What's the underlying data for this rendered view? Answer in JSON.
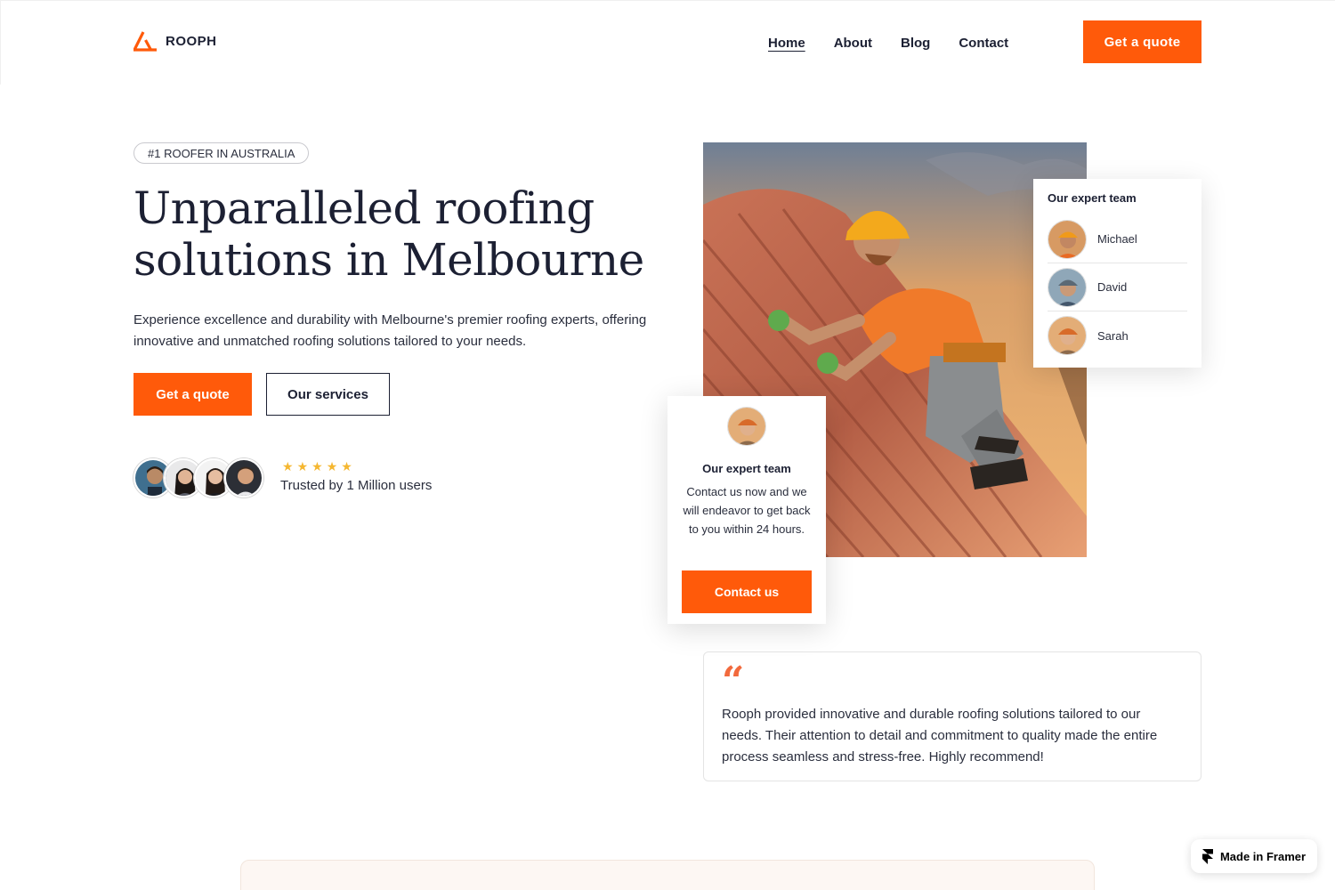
{
  "brand": {
    "name": "ROOPH",
    "accent": "#ff5a0a"
  },
  "nav": {
    "items": [
      {
        "label": "Home",
        "active": true
      },
      {
        "label": "About",
        "active": false
      },
      {
        "label": "Blog",
        "active": false
      },
      {
        "label": "Contact",
        "active": false
      }
    ],
    "cta_label": "Get a quote"
  },
  "hero": {
    "badge": "#1 ROOFER IN AUSTRALIA",
    "title": "Unparalleled roofing solutions in Melbourne",
    "subtitle": "Experience excellence and durability with Melbourne's premier roofing experts, offering innovative and unmatched roofing solutions tailored to your needs.",
    "primary_button": "Get a quote",
    "secondary_button": "Our services",
    "rating_stars": 5,
    "trusted_text": "Trusted by 1 Million users"
  },
  "team_card": {
    "title": "Our expert team",
    "members": [
      {
        "name": "Michael"
      },
      {
        "name": "David"
      },
      {
        "name": "Sarah"
      }
    ]
  },
  "contact_card": {
    "title": "Our expert team",
    "text": "Contact us now and we will endeavor to get back to you within 24 hours.",
    "button": "Contact us"
  },
  "testimonial": {
    "quote_mark": "“",
    "text": "Rooph provided innovative and durable roofing solutions tailored to our needs. Their attention to detail and commitment to quality made the entire process seamless and stress-free. Highly recommend!"
  },
  "framer_badge": {
    "label": "Made in Framer"
  }
}
